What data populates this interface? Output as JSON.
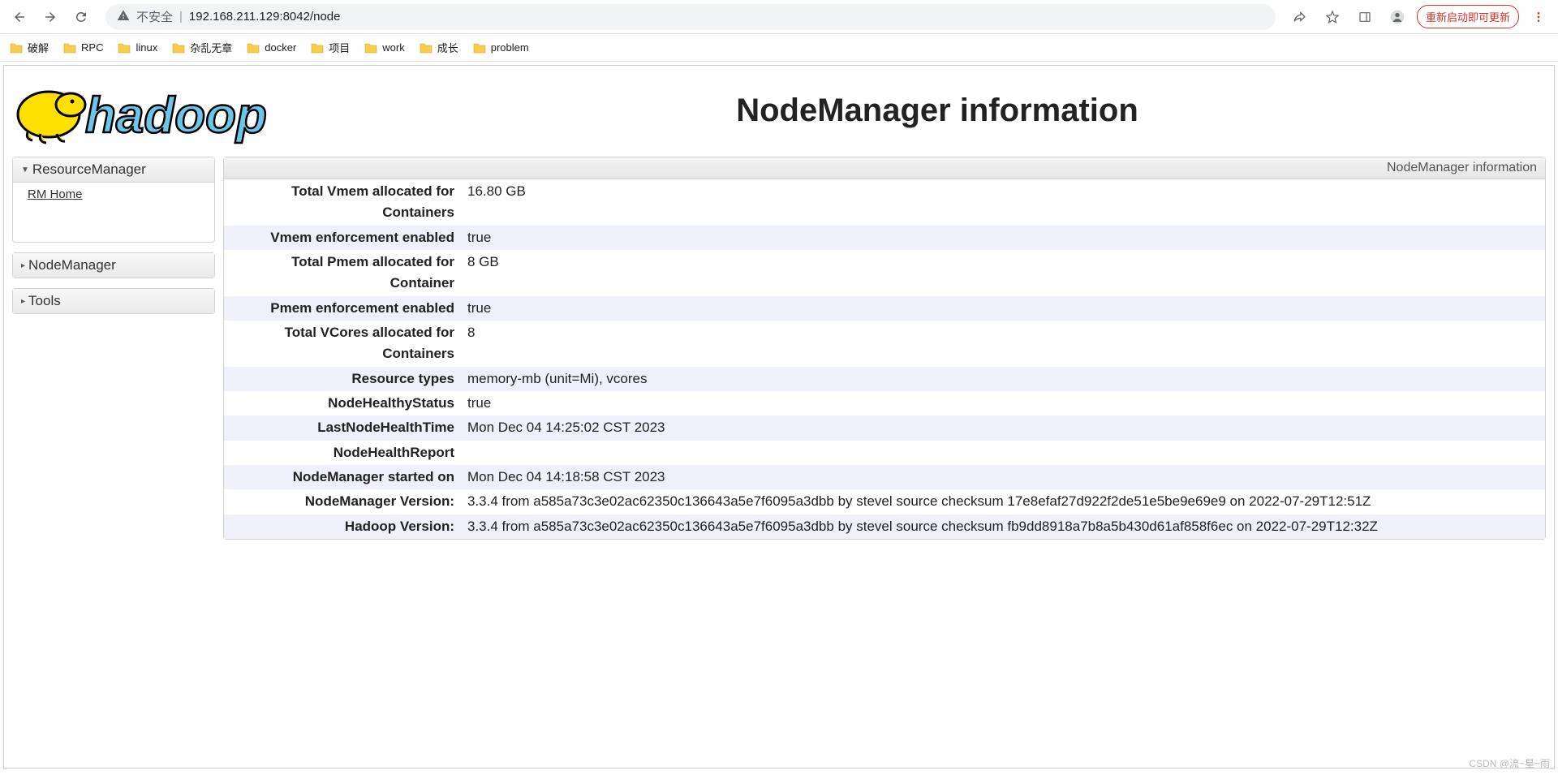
{
  "browser": {
    "insecure_label": "不安全",
    "url": "192.168.211.129:8042/node",
    "update_label": "重新启动即可更新"
  },
  "bookmarks": [
    "破解",
    "RPC",
    "linux",
    "杂乱无章",
    "docker",
    "项目",
    "work",
    "成长",
    "problem"
  ],
  "page_title": "NodeManager information",
  "sidebar": {
    "resource_manager": "ResourceManager",
    "rm_home": "RM Home",
    "node_manager": "NodeManager",
    "tools": "Tools"
  },
  "main": {
    "header": "NodeManager information",
    "rows": [
      {
        "label": "Total Vmem allocated for Containers",
        "value": "16.80 GB"
      },
      {
        "label": "Vmem enforcement enabled",
        "value": "true"
      },
      {
        "label": "Total Pmem allocated for Container",
        "value": "8 GB"
      },
      {
        "label": "Pmem enforcement enabled",
        "value": "true"
      },
      {
        "label": "Total VCores allocated for Containers",
        "value": "8"
      },
      {
        "label": "Resource types",
        "value": "memory-mb (unit=Mi), vcores"
      },
      {
        "label": "NodeHealthyStatus",
        "value": "true"
      },
      {
        "label": "LastNodeHealthTime",
        "value": "Mon Dec 04 14:25:02 CST 2023"
      },
      {
        "label": "NodeHealthReport",
        "value": ""
      },
      {
        "label": "NodeManager started on",
        "value": "Mon Dec 04 14:18:58 CST 2023"
      },
      {
        "label": "NodeManager Version:",
        "value": "3.3.4 from a585a73c3e02ac62350c136643a5e7f6095a3dbb by stevel source checksum 17e8efaf27d922f2de51e5be9e69e9 on 2022-07-29T12:51Z"
      },
      {
        "label": "Hadoop Version:",
        "value": "3.3.4 from a585a73c3e02ac62350c136643a5e7f6095a3dbb by stevel source checksum fb9dd8918a7b8a5b430d61af858f6ec on 2022-07-29T12:32Z"
      }
    ]
  },
  "watermark": "CSDN @流~星~雨"
}
